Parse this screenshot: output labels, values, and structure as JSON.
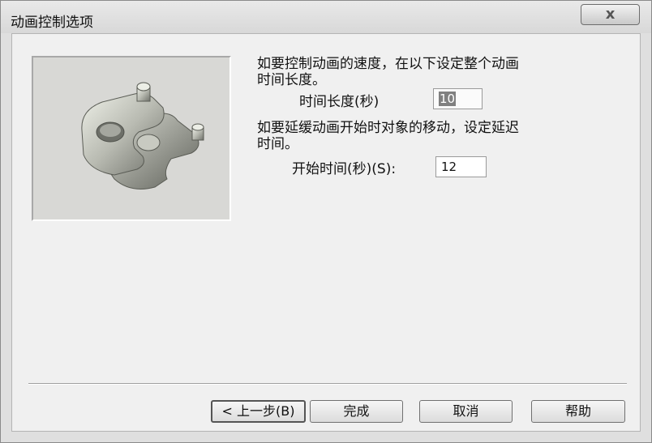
{
  "window": {
    "title": "动画控制选项",
    "close_label": "x"
  },
  "content": {
    "speed_instruction_line1": "如要控制动画的速度，在以下设定整个动画",
    "speed_instruction_line2": "时间长度。",
    "duration_label": "时间长度(秒)",
    "duration_value": "10",
    "delay_instruction_line1": "如要延缓动画开始时对象的移动，设定延迟",
    "delay_instruction_line2": "时间。",
    "start_label": "开始时间(秒)(S):",
    "start_value": "12"
  },
  "buttons": {
    "back": "< 上一步(B)",
    "finish": "完成",
    "cancel": "取消",
    "help": "帮助"
  }
}
